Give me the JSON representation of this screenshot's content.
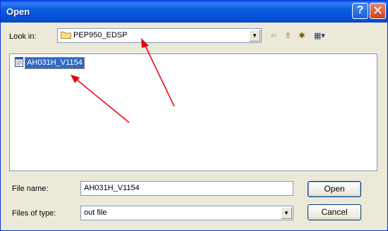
{
  "window": {
    "title": "Open"
  },
  "titlebar_buttons": {
    "help": "?",
    "close": "✕"
  },
  "look_in": {
    "label": "Look in:",
    "value": "PEP950_EDSP",
    "icon": "folder-icon"
  },
  "toolbar": [
    {
      "name": "back-icon",
      "glyph": "⇦"
    },
    {
      "name": "up-folder-icon",
      "glyph": "⇧"
    },
    {
      "name": "new-folder-icon",
      "glyph": "✱"
    },
    {
      "name": "view-menu-icon",
      "glyph": "▦▾"
    }
  ],
  "files": [
    {
      "name": "AH031H_V1154",
      "selected": true,
      "icon": "file-icon"
    }
  ],
  "file_name": {
    "label": "File name:",
    "value": "AH031H_V1154"
  },
  "files_of_type": {
    "label": "Files of type:",
    "value": "out file"
  },
  "buttons": {
    "open": "Open",
    "cancel": "Cancel"
  },
  "colors": {
    "title_bar": "#0a5fe6",
    "selection": "#316ac5",
    "annotation_arrow": "#e8000b",
    "dialog_bg": "#ece9d8"
  }
}
